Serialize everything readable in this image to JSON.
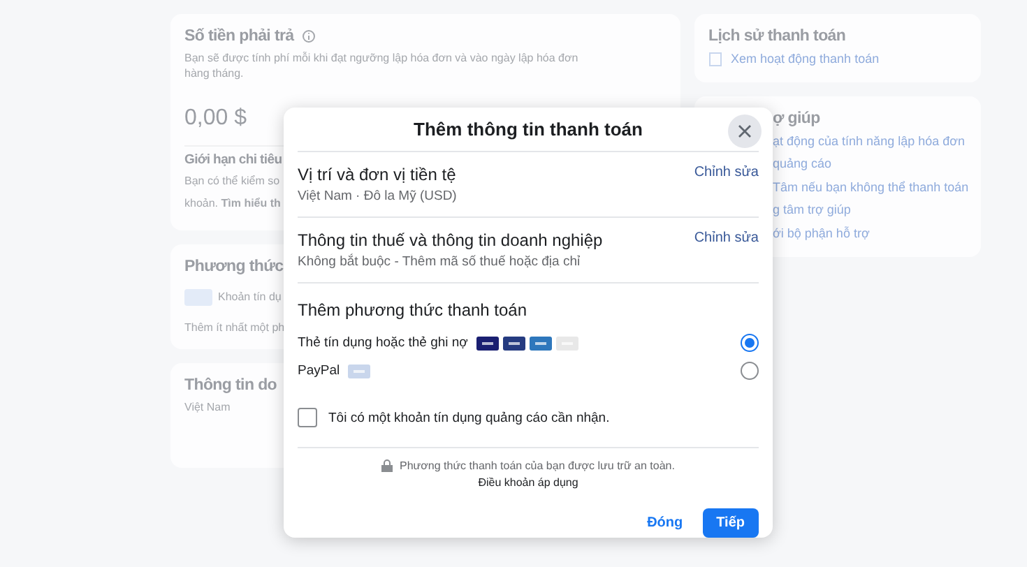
{
  "background": {
    "left_cards": [
      {
        "title": "Số tiền phải trả",
        "info": true,
        "text": "Bạn sẽ được tính phí mỗi khi đạt ngưỡng lập hóa đơn và vào ngày lập hóa đơn hàng tháng.",
        "amount": "0,00 $",
        "sub_title": "Giới hạn chi tiêu",
        "sub_lines": [
          "Bạn có thể kiểm so",
          "khoản. **Tìm hiểu th**"
        ]
      },
      {
        "title": "Phương thức",
        "item": "Khoản tín dụ",
        "note": "Thêm ít nhất một ph"
      },
      {
        "title": "Thông tin do",
        "line": "Việt Nam"
      }
    ],
    "right_cards": [
      {
        "title": "Lịch sử thanh toán",
        "links": [
          "Xem hoạt động thanh toán"
        ]
      },
      {
        "title": "ợ giúp",
        "links": [
          "ạt động của tính năng lập hóa đơn",
          "quảng cáo",
          "Tâm nếu bạn không thể thanh toán",
          "g tâm trợ giúp",
          "ới bộ phận hỗ trợ"
        ]
      }
    ]
  },
  "dialog": {
    "title": "Thêm thông tin thanh toán",
    "sections": [
      {
        "title": "Vị trí và đơn vị tiền tệ",
        "subtitle": "Việt Nam · Đô la Mỹ (USD)",
        "action": "Chỉnh sửa"
      },
      {
        "title": "Thông tin thuế và thông tin doanh nghiệp",
        "subtitle": "Không bắt buộc - Thêm mã số thuế hoặc địa chỉ",
        "action": "Chỉnh sửa"
      }
    ],
    "methods_title": "Thêm phương thức thanh toán",
    "methods": [
      {
        "kind": "card",
        "label": "Thẻ tín dụng hoặc thẻ ghi nợ",
        "selected": true
      },
      {
        "kind": "paypal",
        "label": "PayPal",
        "selected": false
      }
    ],
    "credit": {
      "label": "Tôi có một khoản tín dụng quảng cáo cần nhận.",
      "checked": false
    },
    "secure_note": "Phương thức thanh toán của bạn được lưu trữ an toàn.",
    "terms": "Điều khoản áp dụng",
    "buttons": [
      {
        "kind": "link",
        "label": "Đóng"
      },
      {
        "kind": "primary",
        "label": "Tiếp"
      }
    ]
  }
}
